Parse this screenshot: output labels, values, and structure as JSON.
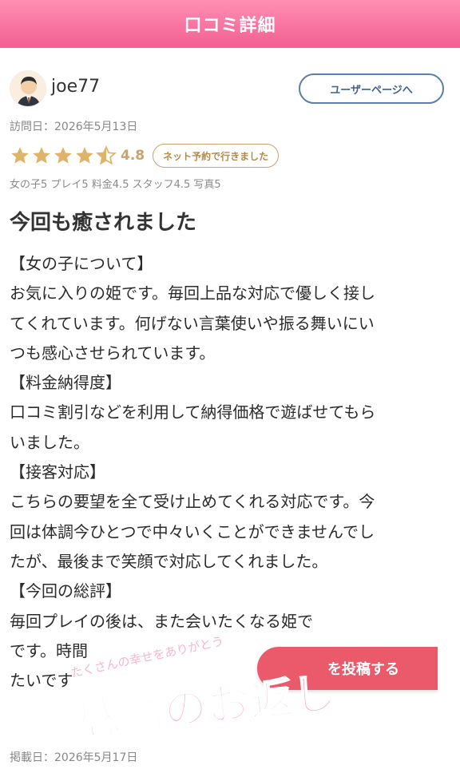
{
  "header": {
    "title": "口コミ詳細"
  },
  "user": {
    "name": "joe77",
    "avatar_icon": "user-avatar-icon",
    "userpage_button": "ユーザーページへ"
  },
  "visit_date": "訪問日：2026年5月13日",
  "rating": {
    "stars": 4.5,
    "score": "4.8",
    "badge": "ネット予約で行きました",
    "star_color": "#e0b36a"
  },
  "sub_ratings": "女の子5 プレイ5 料金4.5 スタッフ4.5 写真5",
  "review": {
    "title": "今回も癒されました",
    "lines": [
      "【女の子について】",
      "お気に入りの姫です。毎回上品な対応で優しく接し",
      "てくれています。何げない言葉使いや振る舞いにい",
      "つも感心させられています。",
      "【料金納得度】",
      "口コミ割引などを利用して納得価格で遊ばせてもら",
      "いました。",
      "【接客対応】",
      "こちらの要望を全て受け止めてくれる対応です。今",
      "回は体調今ひとつで中々いくことができませんでし",
      "たが、最後まで笑顔で対応してくれました。",
      "【今回の総評】",
      "毎回プレイの後は、また会いたくなる姫で",
      "です。時間",
      "たいです"
    ]
  },
  "post_button": "を投稿する",
  "watermark": {
    "main": "感謝のお返し",
    "small": "たくさんの幸せをありがとう"
  },
  "posted_date": "掲載日：2026年5月17日",
  "colors": {
    "header_start": "#ff8fb2",
    "header_end": "#f25f93",
    "button_accent": "#ea5a6a",
    "link_blue": "#3f6491",
    "gold": "#c9a36b"
  }
}
